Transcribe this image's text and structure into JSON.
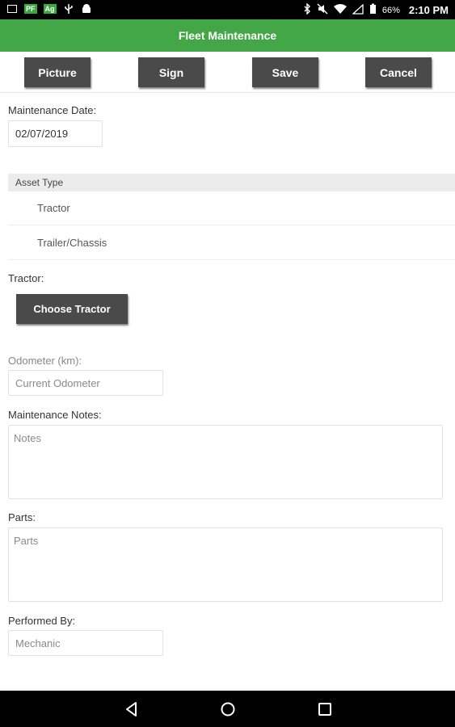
{
  "status_bar": {
    "battery": "66%",
    "time": "2:10 PM",
    "left_icons": [
      "gallery-icon",
      "pf-app-icon",
      "ag-app-icon",
      "usb-icon",
      "android-icon"
    ],
    "left_tags": {
      "pf": "PF",
      "ag": "Ag"
    },
    "right_icons": [
      "bluetooth-icon",
      "mute-icon",
      "wifi-icon",
      "signal-icon",
      "battery-icon"
    ]
  },
  "app": {
    "title": "Fleet Maintenance",
    "accent": "#43a747"
  },
  "toolbar": {
    "picture_label": "Picture",
    "sign_label": "Sign",
    "save_label": "Save",
    "cancel_label": "Cancel"
  },
  "form": {
    "maintenance_date_label": "Maintenance Date:",
    "maintenance_date_value": "02/07/2019",
    "asset_type_header": "Asset Type",
    "asset_types": [
      "Tractor",
      "Trailer/Chassis"
    ],
    "tractor_label": "Tractor:",
    "choose_tractor_label": "Choose Tractor",
    "odometer_label": "Odometer (km):",
    "odometer_placeholder": "Current Odometer",
    "notes_label": "Maintenance Notes:",
    "notes_placeholder": "Notes",
    "parts_label": "Parts:",
    "parts_placeholder": "Parts",
    "performed_by_label": "Performed By:",
    "performed_by_placeholder": "Mechanic"
  },
  "nav_bar": {
    "icons": [
      "back-icon",
      "home-icon",
      "recents-icon"
    ]
  }
}
